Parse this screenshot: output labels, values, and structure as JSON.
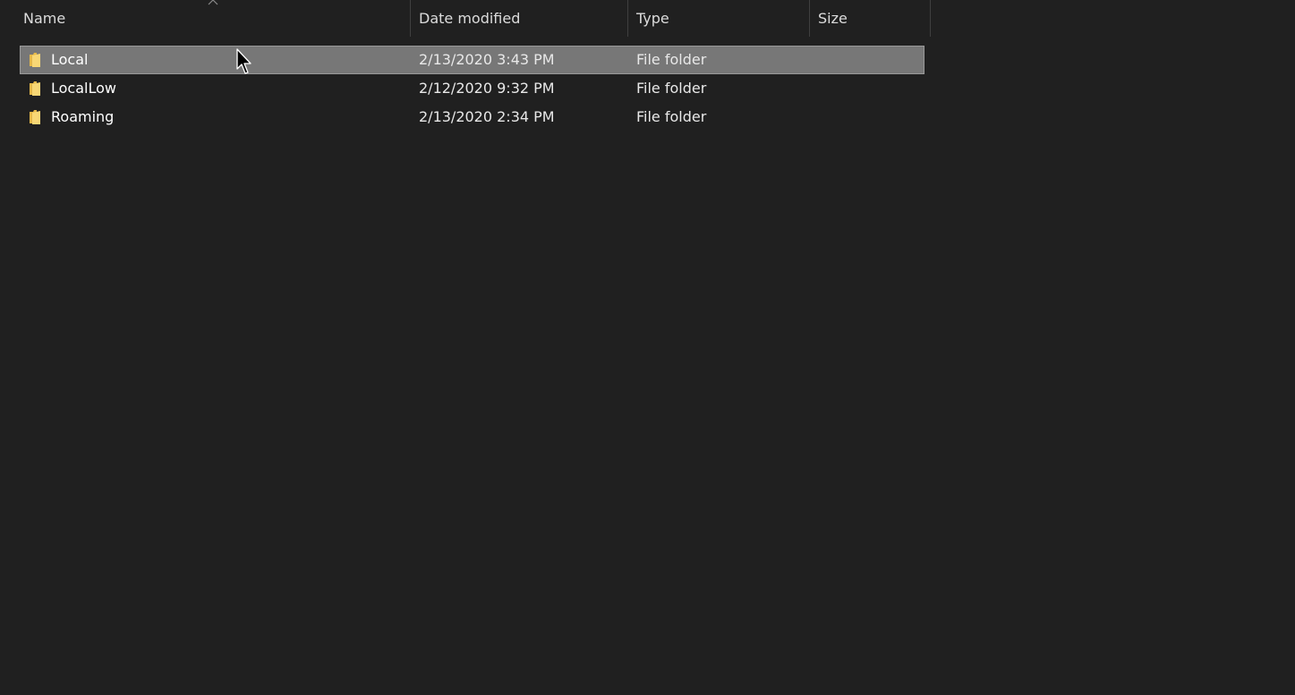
{
  "columns": {
    "name": "Name",
    "date_modified": "Date modified",
    "type": "Type",
    "size": "Size",
    "sort_column": "name",
    "sort_direction": "ascending"
  },
  "rows": [
    {
      "name": "Local",
      "date_modified": "2/13/2020 3:43 PM",
      "type": "File folder",
      "size": "",
      "icon": "folder-icon",
      "selected": true
    },
    {
      "name": "LocalLow",
      "date_modified": "2/12/2020 9:32 PM",
      "type": "File folder",
      "size": "",
      "icon": "folder-icon",
      "selected": false
    },
    {
      "name": "Roaming",
      "date_modified": "2/13/2020 2:34 PM",
      "type": "File folder",
      "size": "",
      "icon": "folder-icon",
      "selected": false
    }
  ],
  "colors": {
    "background": "#202020",
    "selection": "#777777",
    "folder": "#f8d775"
  }
}
